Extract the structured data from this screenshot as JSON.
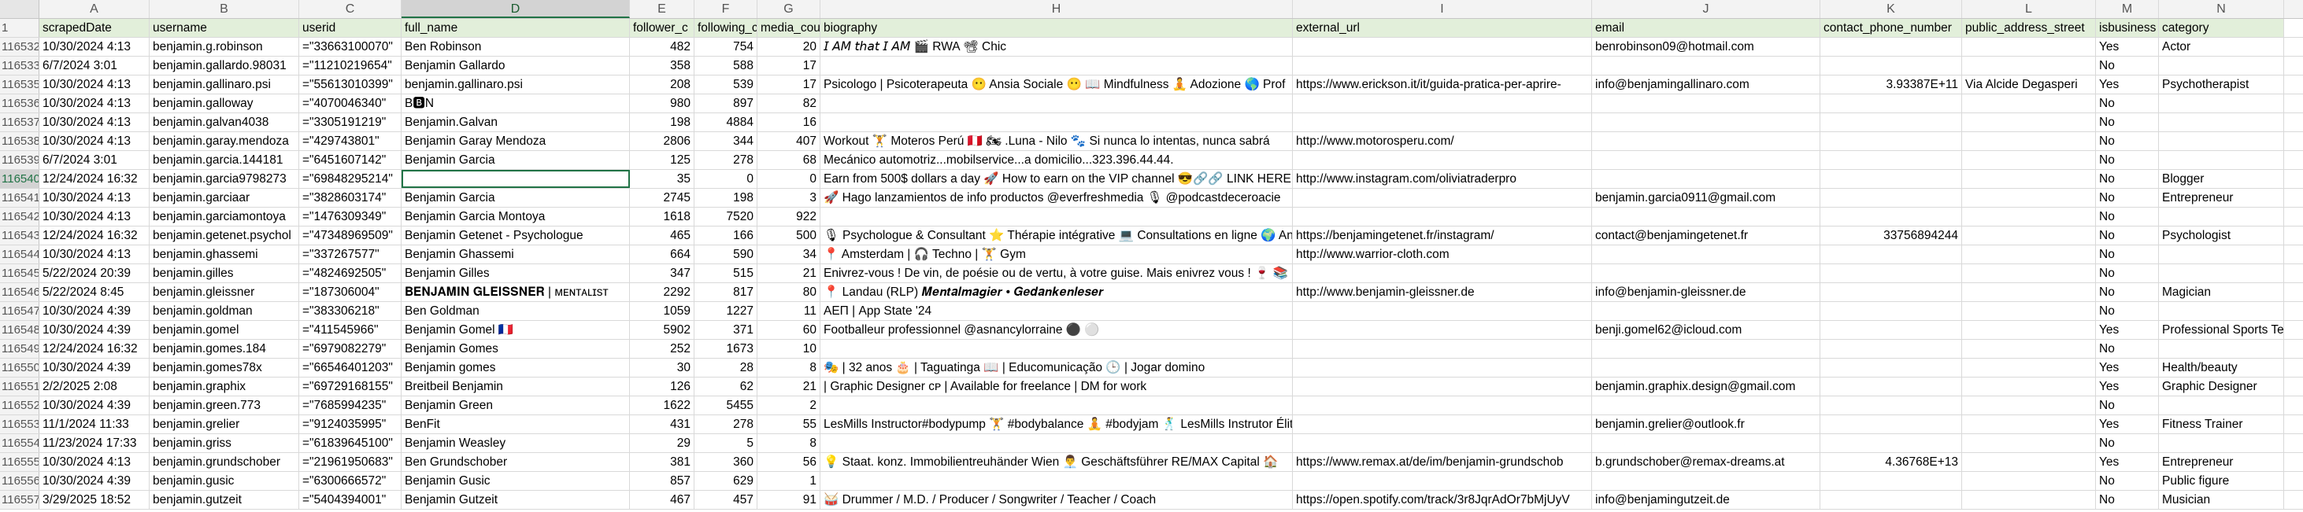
{
  "sheet": {
    "column_letters": [
      "A",
      "B",
      "C",
      "D",
      "E",
      "F",
      "G",
      "H",
      "I",
      "J",
      "K",
      "L",
      "M",
      "N"
    ],
    "selected_column": "D",
    "active_row_number": "116540",
    "header_row": {
      "row_number": "1",
      "fields": [
        "scrapedDate",
        "username",
        "userid",
        "full_name",
        "follower_c",
        "following_c",
        "media_cou",
        "biography",
        "external_url",
        "email",
        "contact_phone_number",
        "public_address_street",
        "isbusiness",
        "category"
      ]
    },
    "rows": [
      {
        "n": "116532",
        "c": [
          "10/30/2024 4:13",
          "benjamin.g.robinson",
          "=\"33663100070\"",
          "Ben Robinson",
          "482",
          "754",
          "20",
          "𝘐 𝘈𝘔 𝘵𝘩𝘢𝘵 𝘐 𝘈𝘔 🎬 RWA 📽 Chic",
          "",
          "benrobinson09@hotmail.com",
          "",
          "",
          "Yes",
          "Actor"
        ]
      },
      {
        "n": "116533",
        "c": [
          "6/7/2024 3:01",
          "benjamin.gallardo.98031",
          "=\"11210219654\"",
          "Benjamin Gallardo",
          "358",
          "588",
          "17",
          "",
          "",
          "",
          "",
          "",
          "No",
          ""
        ]
      },
      {
        "n": "116535",
        "c": [
          "10/30/2024 4:13",
          "benjamin.gallinaro.psi",
          "=\"55613010399\"",
          "benjamin.gallinaro.psi",
          "208",
          "539",
          "17",
          "Psicologo | Psicoterapeuta 😶 Ansia Sociale 😶 📖 Mindfulness 🧘 Adozione 🌎 Prof",
          "https://www.erickson.it/it/guida-pratica-per-aprire-",
          "info@benjamingallinaro.com",
          "3.93387E+11",
          "Via Alcide Degasperi",
          "Yes",
          "Psychotherapist"
        ]
      },
      {
        "n": "116536",
        "c": [
          "10/30/2024 4:13",
          "benjamin.galloway",
          "=\"4070046340\"",
          "B🅱N",
          "980",
          "897",
          "82",
          "",
          "",
          "",
          "",
          "",
          "No",
          ""
        ]
      },
      {
        "n": "116537",
        "c": [
          "10/30/2024 4:13",
          "benjamin.galvan4038",
          "=\"3305191219\"",
          "Benjamin.Galvan",
          "198",
          "4884",
          "16",
          "",
          "",
          "",
          "",
          "",
          "No",
          ""
        ]
      },
      {
        "n": "116538",
        "c": [
          "10/30/2024 4:13",
          "benjamin.garay.mendoza",
          "=\"429743801\"",
          "Benjamin Garay Mendoza",
          "2806",
          "344",
          "407",
          "Workout 🏋 Moteros Perú 🇵🇪 🏍 .Luna - Nilo 🐾 Si nunca lo intentas, nunca sabrá",
          "http://www.motorosperu.com/",
          "",
          "",
          "",
          "No",
          ""
        ]
      },
      {
        "n": "116539",
        "c": [
          "6/7/2024 3:01",
          "benjamin.garcia.144181",
          "=\"6451607142\"",
          "Benjamin Garcia",
          "125",
          "278",
          "68",
          "Mecánico automotriz...mobilservice...a domicilio...323.396.44.44.",
          "",
          "",
          "",
          "",
          "No",
          ""
        ]
      },
      {
        "n": "116540",
        "c": [
          "12/24/2024 16:32",
          "benjamin.garcia9798273",
          "=\"69848295214\"",
          "",
          "35",
          "0",
          "0",
          "Earn from 500$ dollars a day 🚀 How to earn on the VIP channel 😎🔗🔗 LINK HERE👇",
          "http://www.instagram.com/oliviatraderpro",
          "",
          "",
          "",
          "No",
          "Blogger"
        ]
      },
      {
        "n": "116541",
        "c": [
          "10/30/2024 4:13",
          "benjamin.garciaar",
          "=\"3828603174\"",
          "Benjamin Garcia",
          "2745",
          "198",
          "3",
          "🚀 Hago lanzamientos de info productos @everfreshmedia 🎙 @podcastdeceroacie",
          "",
          "benjamin.garcia0911@gmail.com",
          "",
          "",
          "No",
          "Entrepreneur"
        ]
      },
      {
        "n": "116542",
        "c": [
          "10/30/2024 4:13",
          "benjamin.garciamontoya",
          "=\"1476309349\"",
          "Benjamin Garcia Montoya",
          "1618",
          "7520",
          "922",
          "",
          "",
          "",
          "",
          "",
          "No",
          ""
        ]
      },
      {
        "n": "116543",
        "c": [
          "12/24/2024 16:32",
          "benjamin.getenet.psychol",
          "=\"47348969509\"",
          "Benjamin Getenet - Psychologue",
          "465",
          "166",
          "500",
          "🎙 Psychologue & Consultant ⭐ Thérapie intégrative 💻 Consultations en ligne 🌍 An",
          "https://benjamingetenet.fr/instagram/",
          "contact@benjamingetenet.fr",
          "33756894244",
          "",
          "No",
          "Psychologist"
        ]
      },
      {
        "n": "116544",
        "c": [
          "10/30/2024 4:13",
          "benjamin.ghassemi",
          "=\"337267577\"",
          "Benjamin Ghassemi",
          "664",
          "590",
          "34",
          "📍 Amsterdam | 🎧 Techno | 🏋 Gym",
          "http://www.warrior-cloth.com",
          "",
          "",
          "",
          "No",
          ""
        ]
      },
      {
        "n": "116545",
        "c": [
          "5/22/2024 20:39",
          "benjamin.gilles",
          "=\"4824692505\"",
          "Benjamin Gilles",
          "347",
          "515",
          "21",
          "Enivrez-vous ! De vin, de poésie ou de vertu, à votre guise. Mais enivrez vous ! 🍷 📚 Lil",
          "",
          "",
          "",
          "",
          "No",
          ""
        ]
      },
      {
        "n": "116546",
        "c": [
          "5/22/2024 8:45",
          "benjamin.gleissner",
          "=\"187306004\"",
          "𝐁𝐄𝐍𝐉𝐀𝐌𝐈𝐍 𝐆𝐋𝐄𝐈𝐒𝐒𝐍𝐄𝐑 | ᴍᴇɴᴛᴀʟɪsᴛ",
          "2292",
          "817",
          "80",
          "📍 Landau (RLP) 𝑴𝒆𝒏𝒕𝒂𝒍𝒎𝒂𝒈𝒊𝒆𝒓 • 𝑮𝒆𝒅𝒂𝒏𝒌𝒆𝒏𝒍𝒆𝒔𝒆𝒓",
          "http://www.benjamin-gleissner.de",
          "info@benjamin-gleissner.de",
          "",
          "",
          "No",
          "Magician"
        ]
      },
      {
        "n": "116547",
        "c": [
          "10/30/2024 4:39",
          "benjamin.goldman",
          "=\"383306218\"",
          "Ben Goldman",
          "1059",
          "1227",
          "11",
          "ΑΕΠ | App State '24",
          "",
          "",
          "",
          "",
          "No",
          ""
        ]
      },
      {
        "n": "116548",
        "c": [
          "10/30/2024 4:39",
          "benjamin.gomel",
          "=\"411545966\"",
          "Benjamin Gomel 🇫🇷",
          "5902",
          "371",
          "60",
          "Footballeur professionnel @asnancylorraine ⚫ ⚪",
          "",
          "benji.gomel62@icloud.com",
          "",
          "",
          "Yes",
          "Professional Sports Team"
        ]
      },
      {
        "n": "116549",
        "c": [
          "12/24/2024 16:32",
          "benjamin.gomes.184",
          "=\"6979082279\"",
          "Benjamin Gomes",
          "252",
          "1673",
          "10",
          "",
          "",
          "",
          "",
          "",
          "No",
          ""
        ]
      },
      {
        "n": "116550",
        "c": [
          "10/30/2024 4:39",
          "benjamin.gomes78x",
          "=\"66546401203\"",
          "Benjamin gomes",
          "30",
          "28",
          "8",
          "🎭 | 32 anos 🎂 | Taguatinga 📖 | Educomunicação 🕒 | Jogar domino",
          "",
          "",
          "",
          "",
          "Yes",
          "Health/beauty"
        ]
      },
      {
        "n": "116551",
        "c": [
          "2/2/2025 2:08",
          "benjamin.graphix",
          "=\"69729168155\"",
          "Breitbeil Benjamin",
          "126",
          "62",
          "21",
          "| Graphic Designer ᴄᴘ | Available for freelance | DM for work",
          "",
          "benjamin.graphix.design@gmail.com",
          "",
          "",
          "Yes",
          "Graphic Designer"
        ]
      },
      {
        "n": "116552",
        "c": [
          "10/30/2024 4:39",
          "benjamin.green.773",
          "=\"7685994235\"",
          "Benjamin Green",
          "1622",
          "5455",
          "2",
          "",
          "",
          "",
          "",
          "",
          "No",
          ""
        ]
      },
      {
        "n": "116553",
        "c": [
          "11/1/2024 11:33",
          "benjamin.grelier",
          "=\"9124035995\"",
          "BenFit",
          "431",
          "278",
          "55",
          "LesMills Instructor#bodypump 🏋 #bodybalance 🧘 #bodyjam 🕺 LesMills Instrutor Élit",
          "",
          "benjamin.grelier@outlook.fr",
          "",
          "",
          "Yes",
          "Fitness Trainer"
        ]
      },
      {
        "n": "116554",
        "c": [
          "11/23/2024 17:33",
          "benjamin.griss",
          "=\"61839645100\"",
          "Benjamin Weasley",
          "29",
          "5",
          "8",
          "",
          "",
          "",
          "",
          "",
          "No",
          ""
        ]
      },
      {
        "n": "116555",
        "c": [
          "10/30/2024 4:13",
          "benjamin.grundschober",
          "=\"21961950683\"",
          "Ben Grundschober",
          "381",
          "360",
          "56",
          "💡 Staat. konz. Immobilientreuhänder Wien 👨‍💼 Geschäftsführer RE/MAX Capital 🏠",
          "https://www.remax.at/de/im/benjamin-grundschob",
          "b.grundschober@remax-dreams.at",
          "4.36768E+13",
          "",
          "Yes",
          "Entrepreneur"
        ]
      },
      {
        "n": "116556",
        "c": [
          "10/30/2024 4:39",
          "benjamin.gusic",
          "=\"6300666572\"",
          "Benjamin Gusic",
          "857",
          "629",
          "1",
          "",
          "",
          "",
          "",
          "",
          "No",
          "Public figure"
        ]
      },
      {
        "n": "116557",
        "c": [
          "3/29/2025 18:52",
          "benjamin.gutzeit",
          "=\"5404394001\"",
          "Benjamin Gutzeit",
          "467",
          "457",
          "91",
          "🥁 Drummer / M.D. / Producer / Songwriter / Teacher / Coach",
          "https://open.spotify.com/track/3r8JqrAdOr7bMjUyV",
          "info@benjamingutzeit.de",
          "",
          "",
          "No",
          "Musician"
        ]
      }
    ]
  }
}
